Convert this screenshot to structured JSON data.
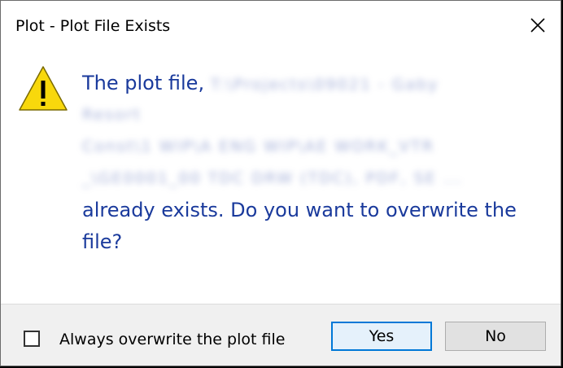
{
  "dialog": {
    "title": "Plot - Plot File Exists",
    "close_glyph": "✕"
  },
  "message": {
    "intro": "The plot file,",
    "path_line_1": "T:\\Projects\\09021 - Gaby",
    "path_line_2": "Resort",
    "path_line_3": "Const\\1 WIP\\A ENG WIP\\AE WORK_VTR",
    "path_line_4": "_\\GE0001_00 TDC DRW (TDC), PDF, SE ...",
    "line_5": "already exists. Do you want to overwrite the",
    "line_6": "file?"
  },
  "footer": {
    "checkbox_label": "Always overwrite the plot file",
    "checkbox_checked": false,
    "yes_label": "Yes",
    "no_label": "No"
  },
  "icons": {
    "warning": "warning-icon",
    "close": "close-icon"
  },
  "colors": {
    "message_text": "#1a3a9c",
    "warning_yellow": "#f8d80c",
    "primary_button_border": "#0078d7"
  }
}
